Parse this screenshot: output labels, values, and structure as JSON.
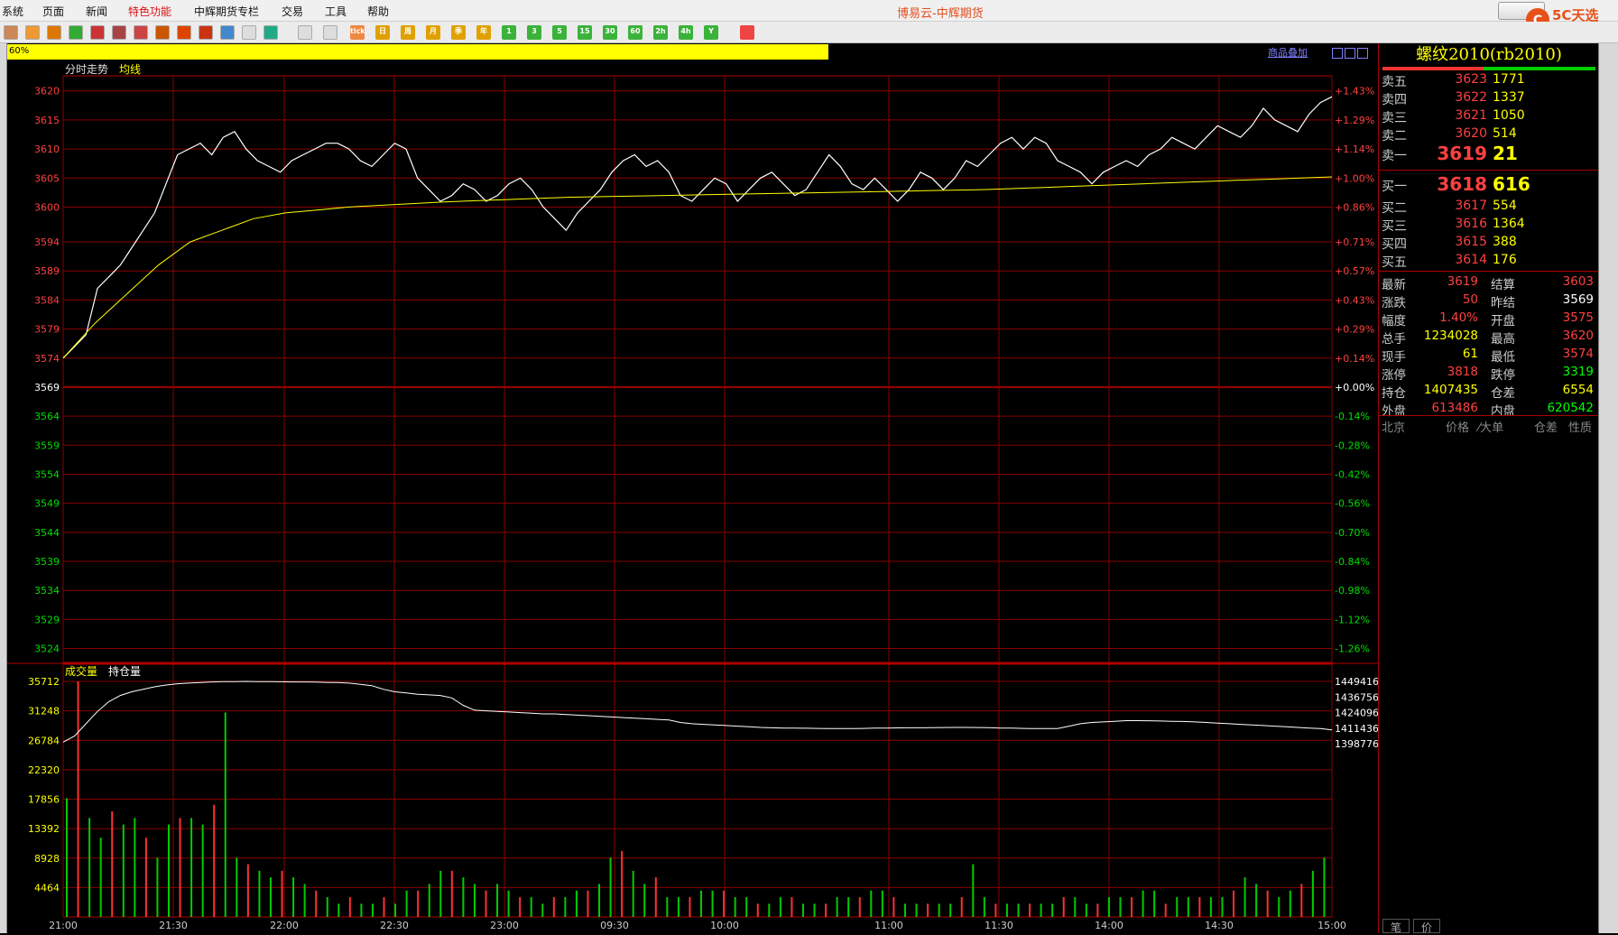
{
  "app_title": "博易云-中辉期货",
  "menu": [
    "系统",
    "页面",
    "新闻",
    "特色功能",
    "中辉期货专栏",
    "交易",
    "工具",
    "帮助"
  ],
  "active_menu": "特色功能",
  "toolbar_boxes": [
    "tick",
    "日",
    "周",
    "月",
    "季",
    "年",
    "1",
    "3",
    "5",
    "15",
    "30",
    "60",
    "2h",
    "4h",
    "Y"
  ],
  "progress_label": "60%",
  "overlay_link": "商品叠加",
  "logo_text": "5C天选",
  "logo_url": "5etz.com",
  "chart": {
    "title": "分时走势",
    "avg_label": "均线",
    "y_prices": [
      3620,
      3615,
      3610,
      3605,
      3600,
      3594,
      3589,
      3584,
      3579,
      3574,
      3569,
      3564,
      3559,
      3554,
      3549,
      3544,
      3539,
      3534,
      3529,
      3524
    ],
    "y_pct": [
      "+1.43%",
      "+1.29%",
      "+1.14%",
      "+1.00%",
      "+0.86%",
      "+0.71%",
      "+0.57%",
      "+0.43%",
      "+0.29%",
      "+0.14%",
      "+0.00%",
      "-0.14%",
      "-0.28%",
      "-0.42%",
      "-0.56%",
      "-0.70%",
      "-0.84%",
      "-0.98%",
      "-1.12%",
      "-1.26%"
    ],
    "vol_label": "成交量",
    "oi_label": "持仓量",
    "vol_ticks": [
      "35712",
      "31248",
      "26784",
      "22320",
      "17856",
      "13392",
      "8928",
      "4464"
    ],
    "oi_ticks": [
      "1449416",
      "1436756",
      "1424096",
      "1411436",
      "1398776"
    ],
    "x_labels": [
      "21:00",
      "21:30",
      "22:00",
      "22:30",
      "23:00",
      "09:30",
      "10:00",
      "11:00",
      "11:30",
      "14:00",
      "14:30",
      "15:00"
    ]
  },
  "chart_data": {
    "type": "line",
    "title": "",
    "xlabel": "",
    "ylabel": "",
    "ylim": [
      3521.6,
      3622.6
    ],
    "prev_settle": 3569,
    "series": [
      {
        "name": "",
        "values": [
          3574,
          3576,
          3578,
          3586,
          3588,
          3590,
          3593,
          3596,
          3599,
          3604,
          3609,
          3610,
          3611,
          3609,
          3612,
          3613,
          3610,
          3608,
          3607,
          3606,
          3608,
          3609,
          3610,
          3611,
          3611,
          3610,
          3608,
          3607,
          3609,
          3611,
          3610,
          3605,
          3603,
          3601,
          3602,
          3604,
          3603,
          3601,
          3602,
          3604,
          3605,
          3603,
          3600,
          3598,
          3596,
          3599,
          3601,
          3603,
          3606,
          3608,
          3609,
          3607,
          3608,
          3606,
          3602,
          3601,
          3603,
          3605,
          3604,
          3601,
          3603,
          3605,
          3606,
          3604,
          3602,
          3603,
          3606,
          3609,
          3607,
          3604,
          3603,
          3605,
          3603,
          3601,
          3603,
          3606,
          3605,
          3603,
          3605,
          3608,
          3607,
          3609,
          3611,
          3612,
          3610,
          3612,
          3611,
          3608,
          3607,
          3606,
          3604,
          3606,
          3607,
          3608,
          3607,
          3609,
          3610,
          3612,
          3611,
          3610,
          3612,
          3614,
          3613,
          3612,
          3614,
          3617,
          3615,
          3614,
          3613,
          3616,
          3618,
          3619
        ]
      },
      {
        "name": "均线",
        "values": [
          3574,
          3580,
          3585,
          3590,
          3594,
          3596,
          3598,
          3599,
          3599.5,
          3600,
          3600.3,
          3600.6,
          3600.9,
          3601.1,
          3601.3,
          3601.5,
          3601.7,
          3601.8,
          3601.9,
          3602,
          3602.1,
          3602.2,
          3602.3,
          3602.4,
          3602.5,
          3602.6,
          3602.7,
          3602.8,
          3602.9,
          3603,
          3603.2,
          3603.4,
          3603.6,
          3603.8,
          3604,
          3604.2,
          3604.4,
          3604.6,
          3604.8,
          3605,
          3605.2
        ]
      }
    ],
    "vol_series": [
      {
        "name": "成交量",
        "values": [
          18000,
          35712,
          15000,
          12000,
          16000,
          14000,
          15000,
          12000,
          9000,
          14000,
          15000,
          15000,
          14000,
          17000,
          31000,
          9000,
          8000,
          7000,
          6000,
          7000,
          6000,
          5000,
          4000,
          3000,
          2000,
          3000,
          2000,
          2000,
          3000,
          2000,
          4000,
          4000,
          5000,
          7000,
          7000,
          6000,
          5000,
          4000,
          5000,
          4000,
          3000,
          3000,
          2000,
          3000,
          3000,
          4000,
          4000,
          5000,
          9000,
          10000,
          7000,
          5000,
          6000,
          3000,
          3000,
          3000,
          4000,
          4000,
          4000,
          3000,
          3000,
          2000,
          2000,
          3000,
          3000,
          2000,
          2000,
          2000,
          3000,
          3000,
          3000,
          4000,
          4000,
          3000,
          2000,
          2000,
          2000,
          2000,
          2000,
          3000,
          8000,
          3000,
          2000,
          2000,
          2000,
          2000,
          2000,
          2000,
          3000,
          3000,
          2000,
          2000,
          3000,
          3000,
          3000,
          4000,
          4000,
          2000,
          3000,
          3000,
          3000,
          3000,
          3000,
          4000,
          6000,
          5000,
          4000,
          3000,
          4000,
          5000,
          7000,
          9000
        ]
      }
    ],
    "oi_series": [
      {
        "name": "持仓量",
        "values": [
          1400000,
          1405000,
          1415000,
          1425000,
          1433000,
          1438000,
          1441000,
          1443000,
          1445000,
          1446500,
          1447500,
          1448000,
          1448500,
          1449000,
          1449200,
          1449300,
          1449416,
          1449300,
          1449200,
          1449100,
          1449000,
          1449000,
          1448800,
          1448600,
          1448500,
          1448000,
          1447000,
          1446000,
          1443000,
          1441000,
          1440000,
          1439000,
          1438500,
          1438000,
          1436000,
          1430000,
          1426000,
          1425500,
          1425000,
          1424500,
          1424000,
          1423500,
          1423000,
          1423000,
          1422500,
          1422000,
          1421500,
          1421000,
          1420500,
          1420000,
          1419500,
          1419000,
          1418500,
          1418000,
          1416000,
          1415000,
          1414500,
          1414000,
          1413500,
          1413000,
          1412500,
          1412000,
          1411700,
          1411500,
          1411400,
          1411300,
          1411200,
          1411100,
          1411000,
          1411000,
          1411200,
          1411400,
          1411500,
          1411600,
          1411700,
          1411700,
          1411800,
          1411900,
          1412000,
          1412000,
          1411900,
          1411800,
          1411500,
          1411400,
          1411200,
          1411000,
          1411000,
          1411000,
          1413000,
          1415000,
          1416000,
          1416500,
          1417000,
          1417500,
          1417500,
          1417400,
          1417200,
          1417000,
          1416800,
          1416500,
          1416000,
          1415500,
          1415000,
          1414500,
          1414000,
          1413500,
          1413000,
          1412500,
          1412000,
          1411500,
          1411000,
          1410000
        ]
      }
    ]
  },
  "panel": {
    "title": "螺纹2010(rb2010)",
    "asks": [
      {
        "label": "卖五",
        "price": "3623",
        "vol": "1771"
      },
      {
        "label": "卖四",
        "price": "3622",
        "vol": "1337"
      },
      {
        "label": "卖三",
        "price": "3621",
        "vol": "1050"
      },
      {
        "label": "卖二",
        "price": "3620",
        "vol": "514"
      },
      {
        "label": "卖一",
        "price": "3619",
        "vol": "21"
      }
    ],
    "bids": [
      {
        "label": "买一",
        "price": "3618",
        "vol": "616"
      },
      {
        "label": "买二",
        "price": "3617",
        "vol": "554"
      },
      {
        "label": "买三",
        "price": "3616",
        "vol": "1364"
      },
      {
        "label": "买四",
        "price": "3615",
        "vol": "388"
      },
      {
        "label": "买五",
        "price": "3614",
        "vol": "176"
      }
    ],
    "quote": [
      {
        "k1": "最新",
        "v1": "3619",
        "c1": "#ff4040",
        "k2": "结算",
        "v2": "3603",
        "c2": "#ff4040"
      },
      {
        "k1": "涨跌",
        "v1": "50",
        "c1": "#ff4040",
        "k2": "昨结",
        "v2": "3569",
        "c2": "#ffffff"
      },
      {
        "k1": "幅度",
        "v1": "1.40%",
        "c1": "#ff4040",
        "k2": "开盘",
        "v2": "3575",
        "c2": "#ff4040"
      },
      {
        "k1": "总手",
        "v1": "1234028",
        "c1": "#ffff00",
        "k2": "最高",
        "v2": "3620",
        "c2": "#ff4040"
      },
      {
        "k1": "现手",
        "v1": "61",
        "c1": "#ffff00",
        "k2": "最低",
        "v2": "3574",
        "c2": "#ff4040"
      },
      {
        "k1": "涨停",
        "v1": "3818",
        "c1": "#ff4040",
        "k2": "跌停",
        "v2": "3319",
        "c2": "#00ff00"
      },
      {
        "k1": "持仓",
        "v1": "1407435",
        "c1": "#ffff00",
        "k2": "仓差",
        "v2": "6554",
        "c2": "#ffff00"
      },
      {
        "k1": "外盘",
        "v1": "613486",
        "c1": "#ff4040",
        "k2": "内盘",
        "v2": "620542",
        "c2": "#00ff00"
      }
    ],
    "foot": [
      "北京",
      "价格",
      "⁄大单",
      "仓差",
      "性质"
    ],
    "bottom_tabs": [
      "笔",
      "价"
    ]
  }
}
